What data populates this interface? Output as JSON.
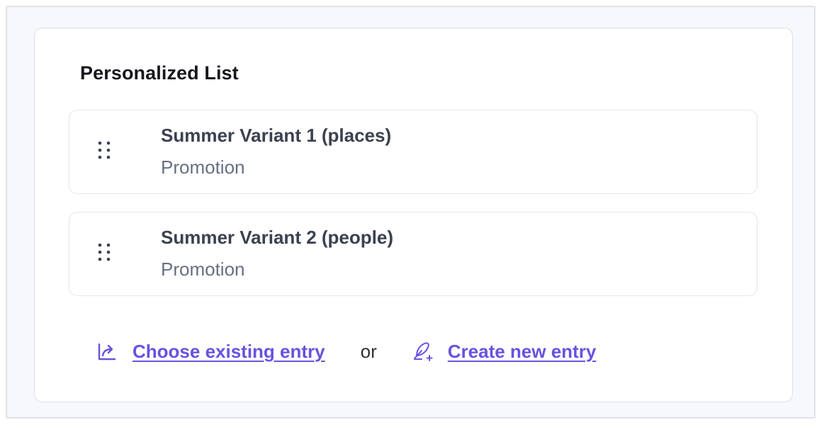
{
  "list": {
    "title": "Personalized List",
    "entries": [
      {
        "title": "Summer Variant 1 (places)",
        "type": "Promotion"
      },
      {
        "title": "Summer Variant 2 (people)",
        "type": "Promotion"
      }
    ]
  },
  "actions": {
    "choose_existing_label": "Choose existing entry",
    "choose_existing_icon": "link-entry-icon",
    "separator": "or",
    "create_new_label": "Create new entry",
    "create_new_icon": "feather-plus-icon"
  },
  "icons": {
    "drag_handle": "drag-handle-icon"
  },
  "colors": {
    "accent": "#6a51e0",
    "title_text": "#16171d",
    "entry_title": "#3b4150",
    "entry_subtitle": "#676f80",
    "background": "#f7f8fc",
    "card_border": "#dcdfe8"
  }
}
